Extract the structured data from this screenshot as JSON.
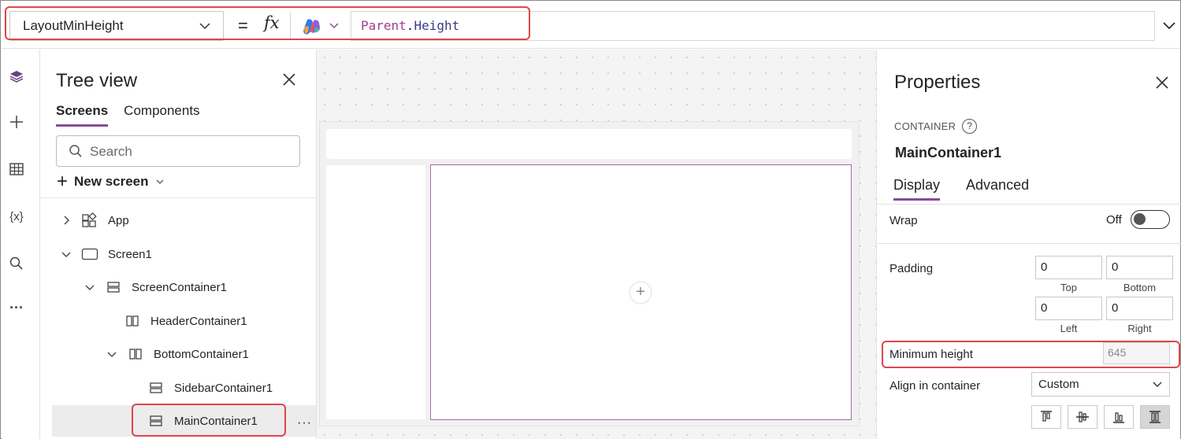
{
  "formula_bar": {
    "property": "LayoutMinHeight",
    "equals": "=",
    "fx": "fx",
    "formula_object": "Parent",
    "formula_dot": ".",
    "formula_prop": "Height"
  },
  "rail": {
    "icons": [
      "layers-icon",
      "insert-plus-icon",
      "data-table-icon",
      "variables-icon",
      "search-icon",
      "more-icon"
    ],
    "variables_glyph": "{x}",
    "more_glyph": "···"
  },
  "tree_view": {
    "title": "Tree view",
    "tabs": [
      "Screens",
      "Components"
    ],
    "search_placeholder": "Search",
    "new_screen": "New screen",
    "nodes": {
      "app": "App",
      "screen1": "Screen1",
      "screen_container": "ScreenContainer1",
      "header_container": "HeaderContainer1",
      "bottom_container": "BottomContainer1",
      "sidebar_container": "SidebarContainer1",
      "main_container": "MainContainer1"
    },
    "more": "···"
  },
  "canvas": {
    "add_glyph": "+"
  },
  "properties": {
    "title": "Properties",
    "control_type": "CONTAINER",
    "help_glyph": "?",
    "control_name": "MainContainer1",
    "tabs": [
      "Display",
      "Advanced"
    ],
    "wrap_label": "Wrap",
    "wrap_state": "Off",
    "padding_label": "Padding",
    "padding": {
      "top": "0",
      "top_label": "Top",
      "bottom": "0",
      "bottom_label": "Bottom",
      "left": "0",
      "left_label": "Left",
      "right": "0",
      "right_label": "Right"
    },
    "min_height_label": "Minimum height",
    "min_height_value": "645",
    "align_label": "Align in container",
    "align_value": "Custom"
  },
  "colors": {
    "highlight": "#e0454a",
    "accent": "#8a4a9a",
    "formula_identifier": "#a03f8a"
  }
}
